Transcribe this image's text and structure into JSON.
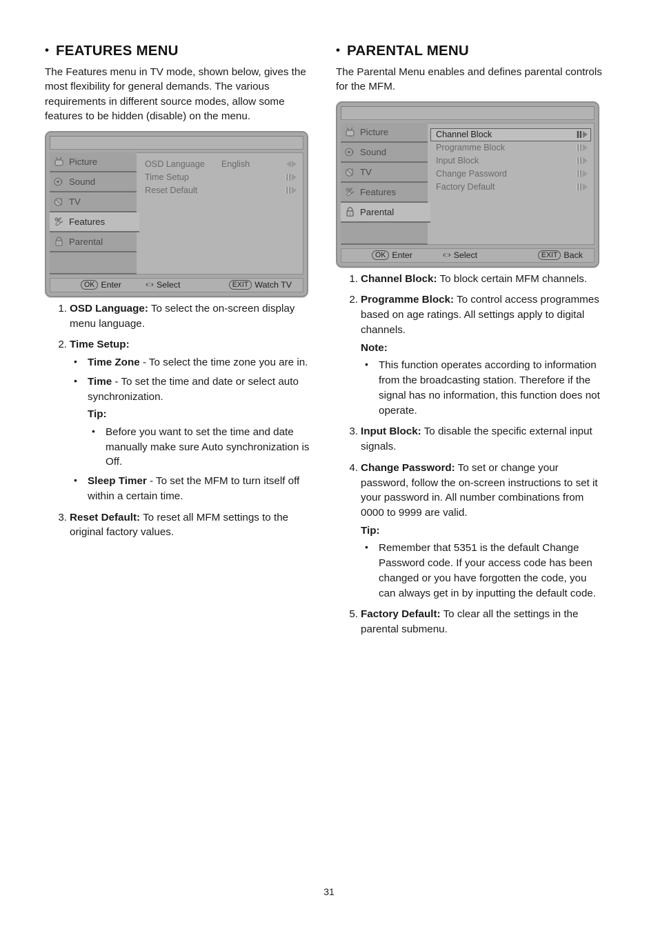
{
  "page": {
    "number": "31"
  },
  "left": {
    "heading": "FEATURES MENU",
    "bullet_char": "•",
    "intro": "The Features menu in TV mode, shown below, gives the most flexibility for general demands. The various requirements in different source modes, allow some features to be hidden (disable) on the menu.",
    "osd": {
      "tabs": [
        {
          "label": "Picture",
          "icon": "tv-icon",
          "active": false
        },
        {
          "label": "Sound",
          "icon": "speaker-icon",
          "active": false
        },
        {
          "label": "TV",
          "icon": "antenna-icon",
          "active": false
        },
        {
          "label": "Features",
          "icon": "wrench-icon",
          "active": true
        },
        {
          "label": "Parental",
          "icon": "lock-icon",
          "active": false
        }
      ],
      "rows": [
        {
          "name": "OSD Language",
          "value": "English",
          "arrows": "leftright",
          "selected": false
        },
        {
          "name": "Time Setup",
          "value": "",
          "arrows": "barright",
          "selected": false
        },
        {
          "name": "Reset Default",
          "value": "",
          "arrows": "barright",
          "selected": false
        }
      ],
      "footer": {
        "ok_key": "OK",
        "ok_label": "Enter",
        "nav_glyph": "‹◌›",
        "nav_label": "Select",
        "exit_key": "EXIT",
        "exit_label": "Watch TV"
      }
    },
    "items": [
      {
        "num": "1.",
        "bold": "OSD Language:",
        "text": " To select the on-screen display menu language."
      },
      {
        "num": "2.",
        "bold": "Time Setup:",
        "text": "",
        "bullets": [
          {
            "bold": "Time Zone",
            "text": " - To select the time zone you are in."
          },
          {
            "bold": "Time",
            "text": " - To set the time and date or select auto synchronization."
          }
        ],
        "tip_label": "Tip:",
        "tip_bullets": [
          {
            "bold": "",
            "text": "Before you want to set the time and date manually make sure Auto synchronization is Off."
          }
        ],
        "bullets_after": [
          {
            "bold": "Sleep Timer",
            "text": " - To set the MFM to turn itself off within a certain time."
          }
        ]
      },
      {
        "num": "3.",
        "bold": "Reset Default:",
        "text": " To reset all MFM settings to the original factory values."
      }
    ]
  },
  "right": {
    "heading": "PARENTAL MENU",
    "bullet_char": "•",
    "intro": "The Parental Menu enables and defines parental controls for the MFM.",
    "osd": {
      "tabs": [
        {
          "label": "Picture",
          "icon": "tv-icon",
          "active": false
        },
        {
          "label": "Sound",
          "icon": "speaker-icon",
          "active": false
        },
        {
          "label": "TV",
          "icon": "antenna-icon",
          "active": false
        },
        {
          "label": "Features",
          "icon": "wrench-icon",
          "active": false
        },
        {
          "label": "Parental",
          "icon": "lock-icon",
          "active": true
        }
      ],
      "rows": [
        {
          "name": "Channel Block",
          "value": "",
          "arrows": "barright",
          "selected": true
        },
        {
          "name": "Programme Block",
          "value": "",
          "arrows": "barright",
          "selected": false
        },
        {
          "name": "Input Block",
          "value": "",
          "arrows": "barright",
          "selected": false
        },
        {
          "name": "Change Password",
          "value": "",
          "arrows": "barright",
          "selected": false
        },
        {
          "name": "Factory Default",
          "value": "",
          "arrows": "barright",
          "selected": false
        }
      ],
      "footer": {
        "ok_key": "OK",
        "ok_label": "Enter",
        "nav_glyph": "‹◌›",
        "nav_label": "Select",
        "exit_key": "EXIT",
        "exit_label": "Back"
      }
    },
    "items": [
      {
        "num": "1.",
        "bold": "Channel Block:",
        "text": " To block certain MFM channels."
      },
      {
        "num": "2.",
        "bold": "Programme Block:",
        "text": " To control access programmes based on age ratings. All settings apply to digital channels.",
        "note_label": "Note:",
        "note_bullets": [
          {
            "text": "This function operates according to information from the broadcasting station. Therefore if the signal has no information, this function does not operate."
          }
        ]
      },
      {
        "num": "3.",
        "bold": "Input Block:",
        "text": " To disable the specific external input signals."
      },
      {
        "num": "4.",
        "bold": "Change Password:",
        "text": " To set or change your password, follow the on-screen instructions to set it your password in. All number combinations from 0000 to 9999 are valid.",
        "tip_label": "Tip:",
        "tip_bullets": [
          {
            "text": "Remember that 5351 is the default Change Password code. If your access code has been changed or you have forgotten the code, you can always get in by inputting the default code."
          }
        ]
      },
      {
        "num": "5.",
        "bold": "Factory Default:",
        "text": " To clear all the settings in the parental submenu."
      }
    ]
  }
}
